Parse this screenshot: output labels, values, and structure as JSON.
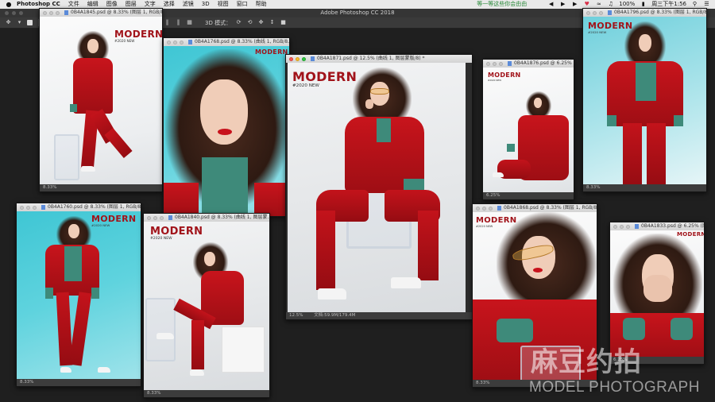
{
  "menubar": {
    "apple": "",
    "app_name": "Photoshop CC",
    "items": [
      "文件",
      "编辑",
      "图像",
      "图层",
      "文字",
      "选择",
      "滤镜",
      "3D",
      "视图",
      "窗口",
      "帮助"
    ],
    "ticker": "等一等这些你会由由",
    "status_icons": [
      "music-controls-icon",
      "heart-icon",
      "wifi-icon",
      "battery-icon"
    ],
    "battery": "100%",
    "clock": "周三下午1:56"
  },
  "ps": {
    "window_title": "Adobe Photoshop CC 2018",
    "options_label_3d": "3D 模式："
  },
  "docs": [
    {
      "id": "doc1",
      "title": "0B4A1845.psd @ 8.33% (图层 1, RGB/8) *",
      "zoom": "8.33%",
      "docsize": ""
    },
    {
      "id": "doc2",
      "title": "0B4A1768.psd @ 8.33% (曲线 1, RGB/8...",
      "zoom": "",
      "docsize": ""
    },
    {
      "id": "doc3",
      "title": "0B4A1871.psd @ 12.5% (曲线 1, 图层蒙版/8) *",
      "zoom": "12.5%",
      "docsize": "文档:59.9M/179.4M"
    },
    {
      "id": "doc4",
      "title": "0B4A1876.psd @ 6.25% (图...",
      "zoom": "6.25%",
      "docsize": ""
    },
    {
      "id": "doc5",
      "title": "0B4A1796.psd @ 8.33% (图层 1, RGB/8)",
      "zoom": "8.33%",
      "docsize": ""
    },
    {
      "id": "doc6",
      "title": "0B4A1760.psd @ 8.33% (图层 1, RGB/8) *",
      "zoom": "8.33%",
      "docsize": ""
    },
    {
      "id": "doc7",
      "title": "0B4A1840.psd @ 8.33% (曲线 1, 图层蒙...",
      "zoom": "8.33%",
      "docsize": ""
    },
    {
      "id": "doc8",
      "title": "0B4A1868.psd @ 8.33% (图层 1, RGB/8...",
      "zoom": "8.33%",
      "docsize": ""
    },
    {
      "id": "doc9",
      "title": "0B4A1833.psd @ 6.25% (图层 1...",
      "zoom": "6.25%",
      "docsize": ""
    }
  ],
  "magazine": {
    "title": "MODERN",
    "sub": "#2020 NEW"
  },
  "watermark": {
    "cn": "麻豆约拍",
    "en": "MODEL PHOTOGRAPH"
  }
}
